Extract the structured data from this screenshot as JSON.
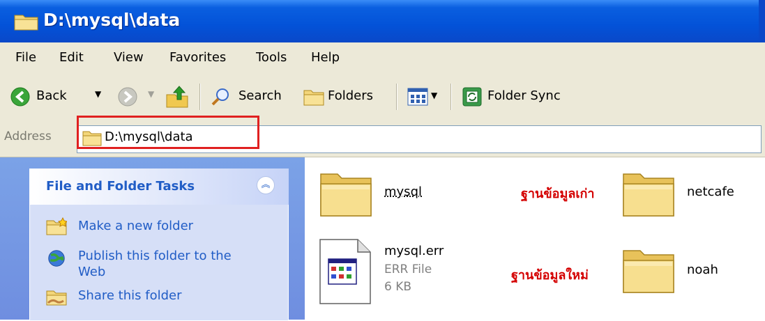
{
  "window": {
    "title": "D:\\mysql\\data"
  },
  "menu": [
    "File",
    "Edit",
    "View",
    "Favorites",
    "Tools",
    "Help"
  ],
  "toolbar": {
    "back": "Back",
    "search": "Search",
    "folders": "Folders",
    "folder_sync": "Folder Sync"
  },
  "address": {
    "label": "Address",
    "value": "D:\\mysql\\data"
  },
  "tasks": {
    "title": "File and Folder Tasks",
    "items": [
      "Make a new folder",
      "Publish this folder to the",
      "Web",
      "Share this folder"
    ]
  },
  "files": [
    {
      "name": "mysql",
      "type": "folder"
    },
    {
      "name": "mysql.err",
      "type": "ERR File",
      "size": "6 KB"
    },
    {
      "name": "netcafe",
      "type": "folder"
    },
    {
      "name": "noah",
      "type": "folder"
    }
  ],
  "annotations": {
    "old_db": "ฐานข้อมูลเก่า",
    "new_db": "ฐานข้อมูลใหม่"
  },
  "colors": {
    "title_bar": "#0352d8",
    "task_pane": "#6f8ee0",
    "link": "#215dc6",
    "highlight": "#e02020",
    "annotation": "#d40000"
  }
}
